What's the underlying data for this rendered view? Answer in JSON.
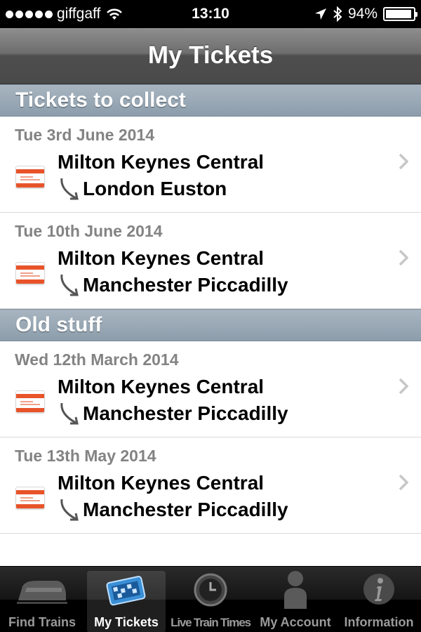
{
  "status_bar": {
    "carrier": "giffgaff",
    "time": "13:10",
    "battery": "94%",
    "battery_level": 0.94,
    "icons": [
      "signal-dots",
      "wifi-icon",
      "location-arrow-icon",
      "bluetooth-icon",
      "battery-icon"
    ]
  },
  "nav": {
    "title": "My Tickets"
  },
  "sections": [
    {
      "title": "Tickets to collect",
      "tickets": [
        {
          "date": "Tue 3rd June 2014",
          "from": "Milton Keynes Central",
          "to": "London Euston"
        },
        {
          "date": "Tue 10th June 2014",
          "from": "Milton Keynes Central",
          "to": "Manchester Piccadilly"
        }
      ]
    },
    {
      "title": "Old stuff",
      "tickets": [
        {
          "date": "Wed 12th March 2014",
          "from": "Milton Keynes Central",
          "to": "Manchester Piccadilly"
        },
        {
          "date": "Tue 13th May 2014",
          "from": "Milton Keynes Central",
          "to": "Manchester Piccadilly"
        }
      ]
    }
  ],
  "tabs": [
    {
      "label": "Find Trains",
      "icon": "train-icon",
      "active": false
    },
    {
      "label": "My Tickets",
      "icon": "tickets-icon",
      "active": true
    },
    {
      "label": "Live Train Times",
      "icon": "clock-icon",
      "active": false
    },
    {
      "label": "My Account",
      "icon": "person-icon",
      "active": false
    },
    {
      "label": "Information",
      "icon": "info-icon",
      "active": false
    }
  ],
  "colors": {
    "ticket_accent": "#e8532a",
    "section_header": "#8c9dab",
    "nav_bar": "#5a5a5a",
    "date_text": "#838383"
  }
}
